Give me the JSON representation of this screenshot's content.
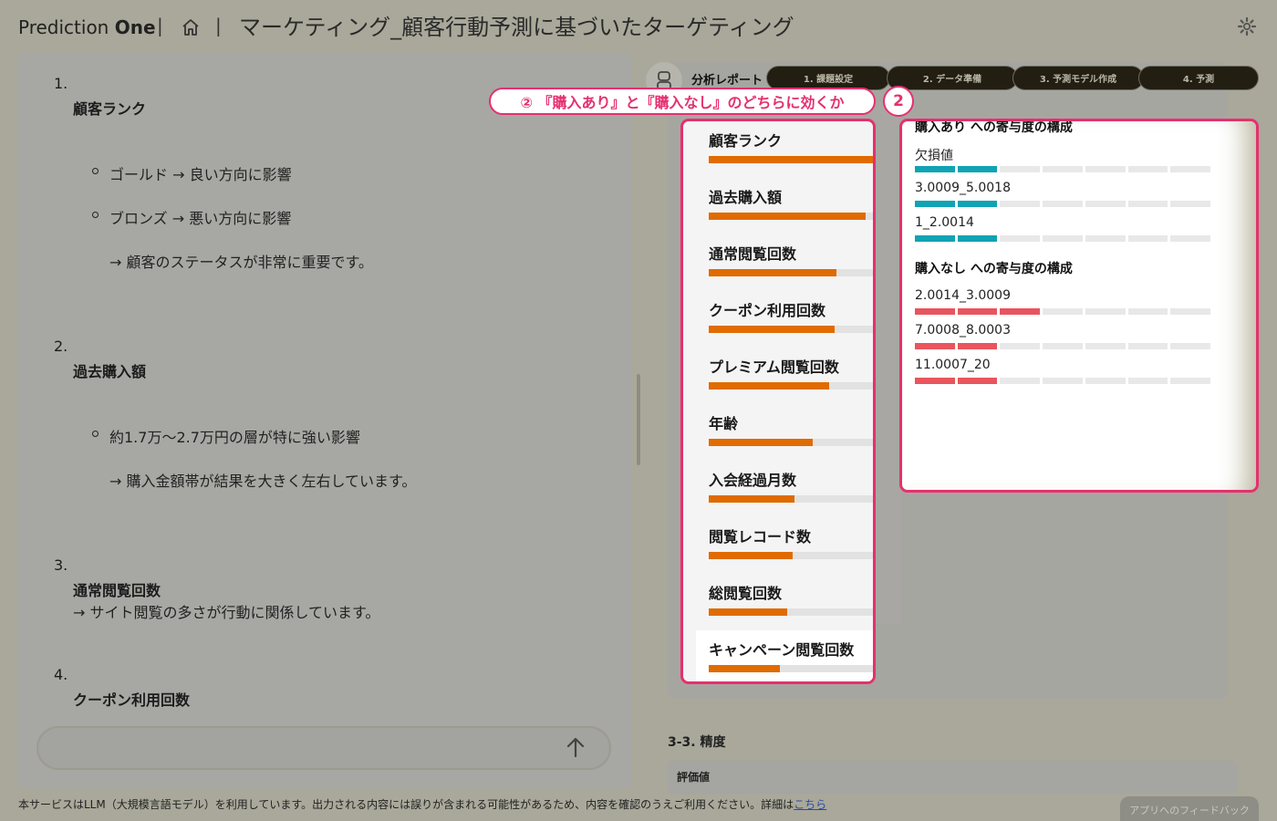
{
  "header": {
    "brand_light": "Prediction ",
    "brand_bold": "One",
    "separator": "|",
    "title": "マーケティング_顧客行動予測に基づいたターゲティング"
  },
  "left": {
    "items": [
      {
        "num": "1.",
        "heading": "顧客ランク"
      },
      {
        "num": "2.",
        "heading": "過去購入額"
      },
      {
        "num": "3.",
        "heading": "通常閲覧回数"
      },
      {
        "num": "4.",
        "heading": "クーポン利用回数"
      }
    ],
    "item1_bullets": [
      "ゴールド → 良い方向に影響",
      "ブロンズ → 悪い方向に影響"
    ],
    "item1_note": "→ 顧客のステータスが非常に重要です。",
    "item2_bullets": [
      "約1.7万～2.7万円の層が特に強い影響"
    ],
    "item2_note": "→ 購入金額帯が結果を大きく左右しています。",
    "item3_note": "→ サイト閲覧の多さが行動に関係しています。",
    "input_placeholder": ""
  },
  "report": {
    "label": "分析レポート",
    "steps": [
      "1. 課題設定",
      "2. データ準備",
      "3. 予測モデル作成",
      "4. 予測"
    ],
    "callout_text": "② 『購入あり』と『購入なし』のどちらに効くか",
    "callout_num": "2",
    "features": [
      {
        "label": "顧客ランク",
        "value": 0.9
      },
      {
        "label": "過去購入額",
        "value": 0.86
      },
      {
        "label": "通常閲覧回数",
        "value": 0.7
      },
      {
        "label": "クーポン利用回数",
        "value": 0.69
      },
      {
        "label": "プレミアム閲覧回数",
        "value": 0.66
      },
      {
        "label": "年齢",
        "value": 0.57
      },
      {
        "label": "入会経過月数",
        "value": 0.47
      },
      {
        "label": "閲覧レコード数",
        "value": 0.46
      },
      {
        "label": "総閲覧回数",
        "value": 0.43
      },
      {
        "label": "キャンペーン閲覧回数",
        "value": 0.39
      }
    ],
    "positive_title": "購入あり への寄与度の構成",
    "positive": [
      {
        "label": "欠損値",
        "level": 2
      },
      {
        "label": "3.0009_5.0018",
        "level": 2
      },
      {
        "label": "1_2.0014",
        "level": 2
      }
    ],
    "negative_title": "購入なし への寄与度の構成",
    "negative": [
      {
        "label": "2.0014_3.0009",
        "level": 3
      },
      {
        "label": "7.0008_8.0003",
        "level": 2
      },
      {
        "label": "11.0007_20",
        "level": 2
      }
    ],
    "accuracy_title": "3-3. 精度",
    "accuracy_label": "評価値"
  },
  "footer": {
    "text": "本サービスはLLM（大規模言語モデル）を利用しています。出力される内容には誤りが含まれる可能性があるため、内容を確認のうえご利用ください。詳細は",
    "link": "こちら",
    "feedback": "アプリへのフィードバック"
  },
  "colors": {
    "accent": "#e5306f",
    "bar_orange": "#e06b00",
    "blue": "#10a3b3",
    "red": "#e8555d"
  }
}
